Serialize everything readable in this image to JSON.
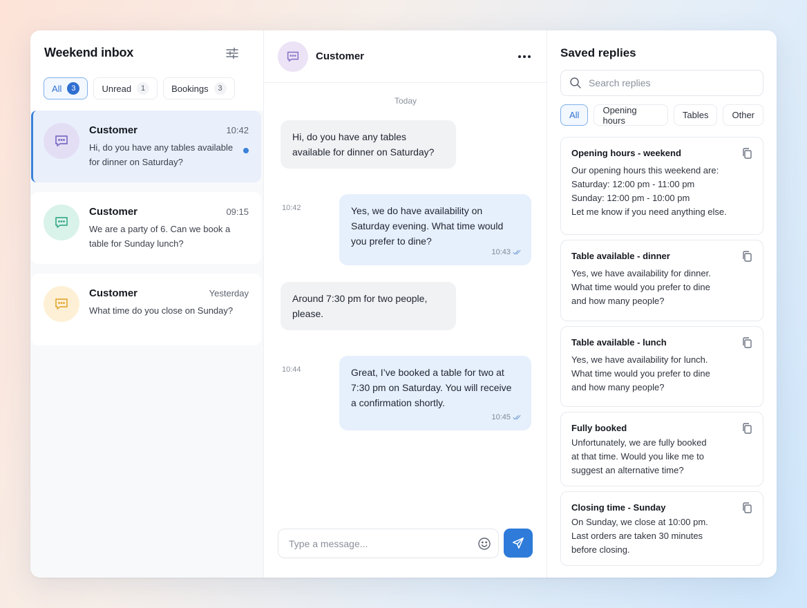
{
  "inbox": {
    "title": "Weekend inbox",
    "tabs": [
      {
        "label": "All",
        "count": "3"
      },
      {
        "label": "Unread",
        "count": "1"
      },
      {
        "label": "Bookings",
        "count": "3"
      }
    ],
    "conversations": [
      {
        "name": "Customer",
        "time": "10:42",
        "preview": "Hi, do you have any tables available for dinner on Saturday?",
        "unread": true,
        "avatar_color": "#e4def5",
        "icon_color": "#7c6bc4"
      },
      {
        "name": "Customer",
        "time": "09:15",
        "preview": "We are a party of 6. Can we book a table for Sunday lunch?",
        "unread": false,
        "avatar_color": "#d9f2ea",
        "icon_color": "#3eab8a"
      },
      {
        "name": "Customer",
        "time": "Yesterday",
        "preview": "What time do you close on Sunday?",
        "unread": false,
        "avatar_color": "#fdf0d6",
        "icon_color": "#e3a93a"
      }
    ]
  },
  "chat": {
    "contact": "Customer",
    "day_label": "Today",
    "messages": [
      {
        "direction": "in",
        "text": "Hi, do you have any tables available for dinner on Saturday?",
        "time": "10:42"
      },
      {
        "direction": "out",
        "text": "Yes, we do have availability on Saturday evening. What time would you prefer to dine?",
        "time": "10:43"
      },
      {
        "direction": "in",
        "text": "Around 7:30 pm for two people, please.",
        "time": "10:44"
      },
      {
        "direction": "out",
        "text": "Great, I’ve booked a table for two at 7:30 pm on Saturday. You will receive a confirmation shortly.",
        "time": "10:45"
      }
    ],
    "composer_placeholder": "Type a message..."
  },
  "replies": {
    "title": "Saved replies",
    "search_placeholder": "Search replies",
    "tabs": [
      "All",
      "Opening hours",
      "Tables",
      "Other"
    ],
    "items": [
      {
        "title": "Opening hours - weekend",
        "body": "Our opening hours this weekend are:\nSaturday: 12:00 pm - 11:00 pm\nSunday: 12:00 pm - 10:00 pm\nLet me know if you need anything else."
      },
      {
        "title": "Table available - dinner",
        "body": "Yes, we have availability for dinner.\nWhat time would you prefer to dine\nand how many people?"
      },
      {
        "title": "Table available - lunch",
        "body": "Yes, we have availability for lunch.\nWhat time would you prefer to dine\nand how many people?"
      },
      {
        "title": "Fully booked",
        "body": "Unfortunately, we are fully booked\nat that time. Would you like me to\nsuggest an alternative time?"
      },
      {
        "title": "Closing time - Sunday",
        "body": "On Sunday, we close at 10:00 pm.\nLast orders are taken 30 minutes\nbefore closing."
      }
    ]
  },
  "colors": {
    "accent": "#2e7bd9",
    "active_row": "#e9f0fc",
    "outgoing_bubble": "#e6f0fc",
    "incoming_bubble": "#f1f2f4"
  }
}
